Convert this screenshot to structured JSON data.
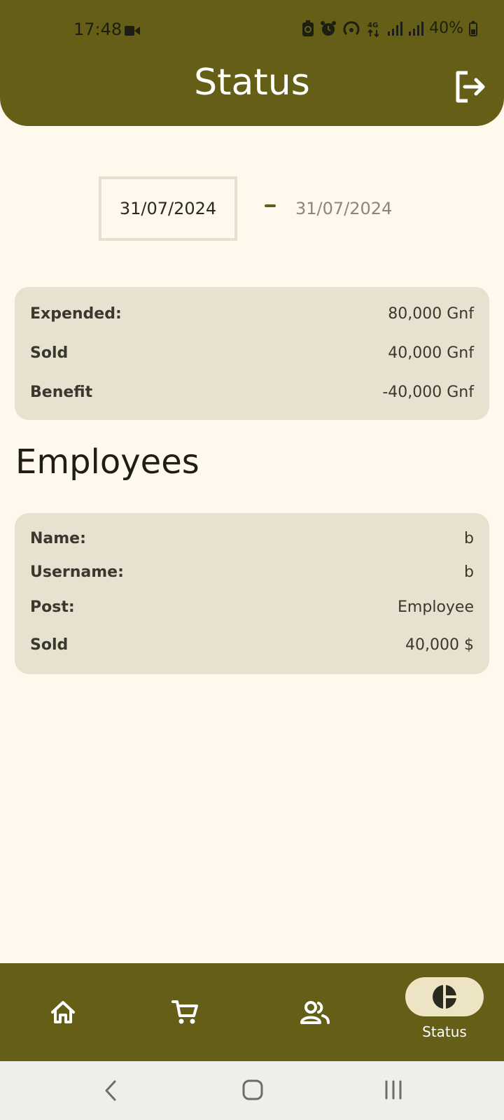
{
  "status_bar": {
    "time": "17:48",
    "battery": "40%"
  },
  "header": {
    "title": "Status"
  },
  "date_range": {
    "start": "31/07/2024",
    "end": "31/07/2024"
  },
  "summary": {
    "rows": [
      {
        "label": "Expended:",
        "value": "80,000 Gnf"
      },
      {
        "label": "Sold",
        "value": "40,000 Gnf"
      },
      {
        "label": "Benefit",
        "value": "-40,000 Gnf"
      }
    ]
  },
  "employees": {
    "title": "Employees",
    "rows": [
      {
        "label": "Name:",
        "value": "b"
      },
      {
        "label": "Username:",
        "value": "b"
      },
      {
        "label": "Post:",
        "value": "Employee"
      },
      {
        "label": "Sold",
        "value": "40,000 $"
      }
    ]
  },
  "bottom_nav": {
    "active_label": "Status",
    "items": [
      {
        "icon": "home-icon"
      },
      {
        "icon": "cart-icon"
      },
      {
        "icon": "people-icon"
      },
      {
        "icon": "pie-chart-icon"
      }
    ]
  },
  "colors": {
    "primary": "#655e17",
    "background": "#fff8ec",
    "card": "#e7e1d0",
    "active_pill": "#ece4c3"
  }
}
